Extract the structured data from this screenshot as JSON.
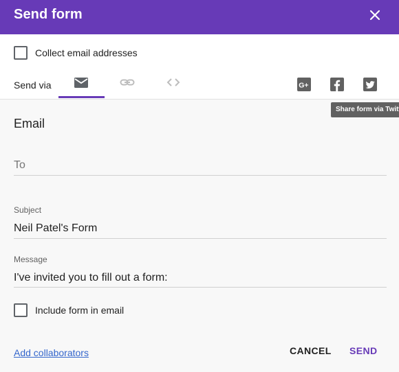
{
  "dialog": {
    "title": "Send form",
    "close_icon": "close-icon"
  },
  "options": {
    "collect_email_label": "Collect email addresses",
    "collect_email_checked": false
  },
  "send_via": {
    "label": "Send via",
    "tabs": [
      {
        "icon": "email-icon",
        "active": true
      },
      {
        "icon": "link-icon",
        "active": false
      },
      {
        "icon": "embed-code-icon",
        "active": false
      }
    ],
    "social": [
      {
        "icon": "google-plus-icon"
      },
      {
        "icon": "facebook-icon"
      },
      {
        "icon": "twitter-icon"
      }
    ],
    "tooltip": "Share form via Twitter"
  },
  "email": {
    "section_title": "Email",
    "to_placeholder": "To",
    "subject_label": "Subject",
    "subject_value": "Neil Patel's Form",
    "message_label": "Message",
    "message_value": "I've invited you to fill out a form:",
    "include_form_label": "Include form in email",
    "include_form_checked": false
  },
  "footer": {
    "add_collaborators": "Add collaborators",
    "cancel": "CANCEL",
    "send": "SEND"
  },
  "colors": {
    "accent": "#673ab7",
    "link": "#3366cc"
  }
}
